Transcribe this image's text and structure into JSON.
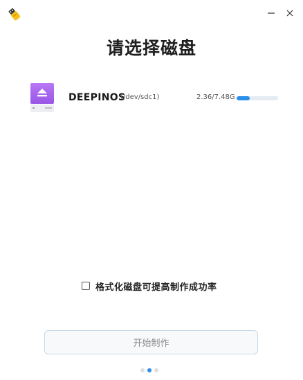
{
  "window": {
    "logo_icon": "usb-drive-icon",
    "minimize_icon": "minimize-icon",
    "close_icon": "close-icon"
  },
  "page": {
    "title": "请选择磁盘"
  },
  "disks": [
    {
      "name": "DEEPINOS",
      "path": "(/dev/sdc1)",
      "usage": "2.36/7.48G",
      "usage_fraction": 0.315,
      "icon": "removable-disk-icon"
    }
  ],
  "options": {
    "format_label": "格式化磁盘可提高制作成功率",
    "format_checked": false
  },
  "actions": {
    "start_label": "开始制作",
    "start_enabled": false
  },
  "pagination": {
    "total": 3,
    "current": 2
  },
  "colors": {
    "accent": "#2a8fe8",
    "disk_icon": "#b06cf0"
  }
}
